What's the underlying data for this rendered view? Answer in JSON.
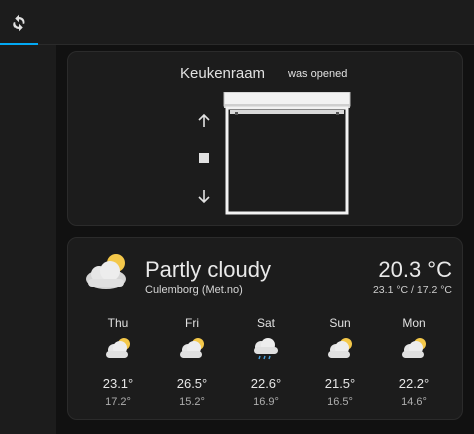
{
  "header": {
    "tab_icon": "refresh-icon",
    "accent": "#03a9f4"
  },
  "cover": {
    "name": "Keukenraam",
    "state": "was opened",
    "controls": [
      "arrow-up-icon",
      "stop-icon",
      "arrow-down-icon"
    ]
  },
  "weather": {
    "condition": "Partly cloudy",
    "location": "Culemborg (Met.no)",
    "temperature": "20.3 °C",
    "range": "23.1 °C / 17.2 °C",
    "icon": "partly-cloudy-icon",
    "forecast": [
      {
        "day": "Thu",
        "high": "23.1°",
        "low": "17.2°",
        "icon": "partly-cloudy-icon"
      },
      {
        "day": "Fri",
        "high": "26.5°",
        "low": "15.2°",
        "icon": "partly-cloudy-icon"
      },
      {
        "day": "Sat",
        "high": "22.6°",
        "low": "16.9°",
        "icon": "rainy-icon"
      },
      {
        "day": "Sun",
        "high": "21.5°",
        "low": "16.5°",
        "icon": "partly-cloudy-icon"
      },
      {
        "day": "Mon",
        "high": "22.2°",
        "low": "14.6°",
        "icon": "partly-cloudy-icon"
      }
    ]
  }
}
